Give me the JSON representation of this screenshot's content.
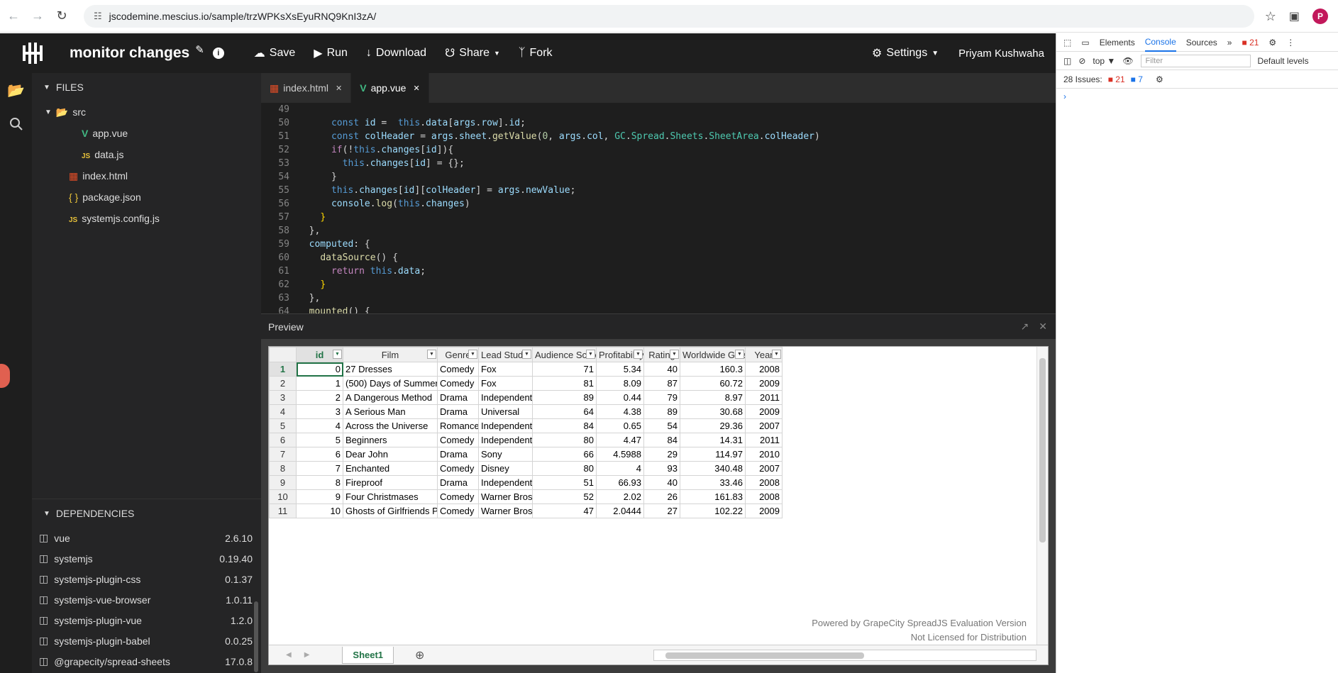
{
  "browser": {
    "url": "jscodemine.mescius.io/sample/trzWPKsXsEyuRNQ9KnI3zA/",
    "avatar_letter": "P"
  },
  "header": {
    "title": "monitor changes",
    "toolbar": [
      {
        "name": "save",
        "icon": "cloud-upload-icon",
        "label": "Save"
      },
      {
        "name": "run",
        "icon": "play-icon",
        "label": "Run"
      },
      {
        "name": "download",
        "icon": "download-icon",
        "label": "Download"
      },
      {
        "name": "share",
        "icon": "share-icon",
        "label": "Share"
      },
      {
        "name": "fork",
        "icon": "fork-icon",
        "label": "Fork"
      }
    ],
    "settings_label": "Settings",
    "user_name": "Priyam Kushwaha"
  },
  "sidebar": {
    "files_title": "FILES",
    "files": [
      {
        "label": "src",
        "icon": "folder-open-icon",
        "indent": 1
      },
      {
        "label": "app.vue",
        "icon": "vue-icon",
        "indent": 3
      },
      {
        "label": "data.js",
        "icon": "js-icon",
        "indent": 3
      },
      {
        "label": "index.html",
        "icon": "html-icon",
        "indent": 2
      },
      {
        "label": "package.json",
        "icon": "json-icon",
        "indent": 2
      },
      {
        "label": "systemjs.config.js",
        "icon": "js-icon",
        "indent": 2
      }
    ],
    "deps_title": "DEPENDENCIES",
    "dependencies": [
      {
        "name": "vue",
        "version": "2.6.10"
      },
      {
        "name": "systemjs",
        "version": "0.19.40"
      },
      {
        "name": "systemjs-plugin-css",
        "version": "0.1.37"
      },
      {
        "name": "systemjs-vue-browser",
        "version": "1.0.11"
      },
      {
        "name": "systemjs-plugin-vue",
        "version": "1.2.0"
      },
      {
        "name": "systemjs-plugin-babel",
        "version": "0.0.25"
      },
      {
        "name": "@grapecity/spread-sheets",
        "version": "17.0.8"
      }
    ]
  },
  "editor": {
    "tabs": [
      {
        "label": "index.html",
        "icon": "html-icon",
        "active": false
      },
      {
        "label": "app.vue",
        "icon": "vue-icon",
        "active": true
      }
    ],
    "lines": [
      {
        "n": "49",
        "html": ""
      },
      {
        "n": "50",
        "html": "      <span class='b'>const</span> <span class='v'>id</span> =  <span class='b'>this</span>.<span class='v'>data</span>[<span class='v'>args</span>.<span class='v'>row</span>].<span class='v'>id</span>;"
      },
      {
        "n": "51",
        "html": "      <span class='b'>const</span> <span class='v'>colHeader</span> = <span class='v'>args</span>.<span class='v'>sheet</span>.<span class='f'>getValue</span>(<span class='n'>0</span>, <span class='v'>args</span>.<span class='v'>col</span>, <span class='g'>GC</span>.<span class='g'>Spread</span>.<span class='g'>Sheets</span>.<span class='g'>SheetArea</span>.<span class='v'>colHeader</span>)"
      },
      {
        "n": "52",
        "html": "      <span class='k'>if</span>(!<span class='b'>this</span>.<span class='v'>changes</span>[<span class='v'>id</span>]){"
      },
      {
        "n": "53",
        "html": "        <span class='b'>this</span>.<span class='v'>changes</span>[<span class='v'>id</span>] = {};"
      },
      {
        "n": "54",
        "html": "      }"
      },
      {
        "n": "55",
        "html": "      <span class='b'>this</span>.<span class='v'>changes</span>[<span class='v'>id</span>][<span class='v'>colHeader</span>] = <span class='v'>args</span>.<span class='v'>newValue</span>;"
      },
      {
        "n": "56",
        "html": "      <span class='v'>console</span>.<span class='f'>log</span>(<span class='b'>this</span>.<span class='v'>changes</span>)"
      },
      {
        "n": "57",
        "html": "    <span class='y'>}</span>"
      },
      {
        "n": "58",
        "html": "  },"
      },
      {
        "n": "59",
        "html": "  <span class='v'>computed</span>: {"
      },
      {
        "n": "60",
        "html": "    <span class='f'>dataSource</span>() {"
      },
      {
        "n": "61",
        "html": "      <span class='k'>return</span> <span class='b'>this</span>.<span class='v'>data</span>;"
      },
      {
        "n": "62",
        "html": "    <span class='y'>}</span>"
      },
      {
        "n": "63",
        "html": "  },"
      },
      {
        "n": "64",
        "html": "  <span class='f'>mounted</span>() {"
      }
    ]
  },
  "preview": {
    "title": "Preview",
    "columns": [
      "id",
      "Film",
      "Genre",
      "Lead Studio",
      "Audience Score %",
      "Profitability",
      "Rating",
      "Worldwide Gross",
      "Year"
    ],
    "rows": [
      [
        "0",
        "27 Dresses",
        "Comedy",
        "Fox",
        "71",
        "5.34",
        "40",
        "160.3",
        "2008"
      ],
      [
        "1",
        "(500) Days of Summer",
        "Comedy",
        "Fox",
        "81",
        "8.09",
        "87",
        "60.72",
        "2009"
      ],
      [
        "2",
        "A Dangerous Method",
        "Drama",
        "Independent",
        "89",
        "0.44",
        "79",
        "8.97",
        "2011"
      ],
      [
        "3",
        "A Serious Man",
        "Drama",
        "Universal",
        "64",
        "4.38",
        "89",
        "30.68",
        "2009"
      ],
      [
        "4",
        "Across the Universe",
        "Romance",
        "Independent",
        "84",
        "0.65",
        "54",
        "29.36",
        "2007"
      ],
      [
        "5",
        "Beginners",
        "Comedy",
        "Independent",
        "80",
        "4.47",
        "84",
        "14.31",
        "2011"
      ],
      [
        "6",
        "Dear John",
        "Drama",
        "Sony",
        "66",
        "4.5988",
        "29",
        "114.97",
        "2010"
      ],
      [
        "7",
        "Enchanted",
        "Comedy",
        "Disney",
        "80",
        "4",
        "93",
        "340.48",
        "2007"
      ],
      [
        "8",
        "Fireproof",
        "Drama",
        "Independent",
        "51",
        "66.93",
        "40",
        "33.46",
        "2008"
      ],
      [
        "9",
        "Four Christmases",
        "Comedy",
        "Warner Bros.",
        "52",
        "2.02",
        "26",
        "161.83",
        "2008"
      ],
      [
        "10",
        "Ghosts of Girlfriends Past",
        "Comedy",
        "Warner Bros.",
        "47",
        "2.0444",
        "27",
        "102.22",
        "2009"
      ]
    ],
    "watermark_line1": "Powered by GrapeCity SpreadJS Evaluation Version",
    "watermark_line2": "Not Licensed for Distribution",
    "sheet_tab": "Sheet1"
  },
  "devtools": {
    "tabs": [
      "Elements",
      "Console",
      "Sources"
    ],
    "active_tab": "Console",
    "badge_count": "21",
    "context": "top",
    "filter_placeholder": "Filter",
    "levels": "Default levels",
    "issues_label": "28 Issues:",
    "issues_errors": "21",
    "issues_info": "7"
  }
}
